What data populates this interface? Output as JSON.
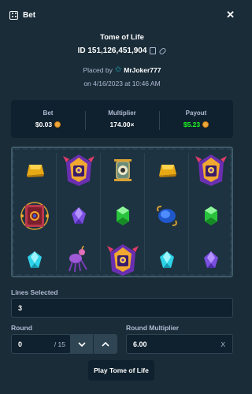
{
  "header": {
    "title": "Bet",
    "close_icon": "close-icon",
    "bet_icon": "dice-icon"
  },
  "game": {
    "name": "Tome of Life",
    "bet_id": "ID 151,126,451,904"
  },
  "placed": {
    "prefix": "Placed by",
    "user": "MrJoker777",
    "date": "on 4/16/2023 at 10:46 AM"
  },
  "stats": {
    "bet": {
      "label": "Bet",
      "value": "$0.03"
    },
    "multiplier": {
      "label": "Multiplier",
      "value": "174.00×"
    },
    "payout": {
      "label": "Payout",
      "value": "$5.23"
    }
  },
  "board": {
    "reels": [
      [
        "gold-bar",
        "tome-portal",
        "cyan-gem"
      ],
      [
        "priest-mask",
        "purple-gem",
        "spider-creature"
      ],
      [
        "eye-totem",
        "green-gem",
        "priest-mask"
      ],
      [
        "gold-bar",
        "blue-scarab",
        "cyan-gem"
      ],
      [
        "priest-mask",
        "green-gem",
        "purple-gem"
      ]
    ]
  },
  "lines": {
    "label": "Lines Selected",
    "value": "3"
  },
  "round": {
    "label": "Round",
    "value": "0",
    "total": "/ 15"
  },
  "round_multiplier": {
    "label": "Round Multiplier",
    "value": "6.00",
    "suffix": "X"
  },
  "play_button": "Play Tome of Life",
  "colors": {
    "background": "#1a2c38",
    "panel": "#0f212e",
    "payout_green": "#1fff20"
  }
}
